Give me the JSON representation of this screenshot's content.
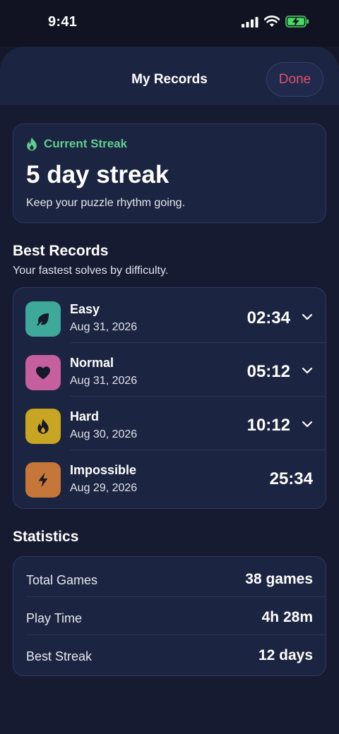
{
  "status_bar": {
    "time": "9:41"
  },
  "header": {
    "title": "My Records",
    "done_label": "Done"
  },
  "streak": {
    "label": "Current Streak",
    "value": "5 day streak",
    "subtitle": "Keep your puzzle rhythm going."
  },
  "best_records": {
    "title": "Best Records",
    "subtitle": "Your fastest solves by difficulty.",
    "items": [
      {
        "name": "Easy",
        "date": "Aug 31, 2026",
        "time": "02:34",
        "color": "#3ea99a",
        "icon": "leaf-icon",
        "expandable": true
      },
      {
        "name": "Normal",
        "date": "Aug 31, 2026",
        "time": "05:12",
        "color": "#c65f9e",
        "icon": "heart-icon",
        "expandable": true
      },
      {
        "name": "Hard",
        "date": "Aug 30, 2026",
        "time": "10:12",
        "color": "#c8a623",
        "icon": "flame-icon",
        "expandable": true
      },
      {
        "name": "Impossible",
        "date": "Aug 29, 2026",
        "time": "25:34",
        "color": "#c7763a",
        "icon": "bolt-icon",
        "expandable": false
      }
    ]
  },
  "statistics": {
    "title": "Statistics",
    "items": [
      {
        "label": "Total Games",
        "value": "38 games"
      },
      {
        "label": "Play Time",
        "value": "4h 28m"
      },
      {
        "label": "Best Streak",
        "value": "12 days"
      }
    ]
  },
  "colors": {
    "accent_green": "#5fd08e",
    "done_red": "#e0506a",
    "background": "#15182a",
    "card": "#1b2440"
  }
}
